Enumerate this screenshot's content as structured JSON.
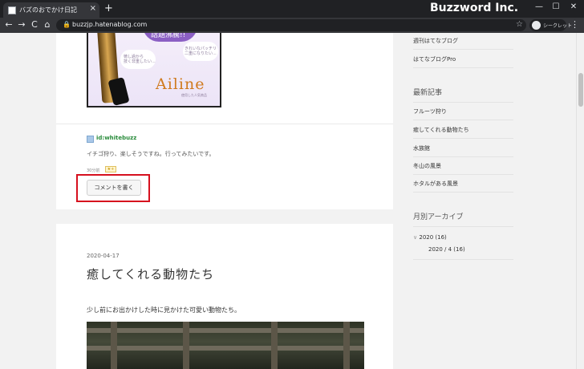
{
  "browser": {
    "tab_title": "バズのおでかけ日記",
    "new_tab": "+",
    "close": "×",
    "brand": "Buzzword Inc.",
    "url": "buzzjp.hatenablog.com",
    "incognito_label": "シークレット",
    "nav": {
      "back": "←",
      "forward": "→",
      "reload": "C",
      "home": "⌂"
    },
    "window": {
      "minimize": "—",
      "maximize": "☐",
      "close": "✕"
    },
    "star": "☆",
    "menu": "⋮",
    "lock": "🔒"
  },
  "ad": {
    "bubble_text": "話題沸騰!!",
    "note_left": "徳し過から\n技く非重したい...",
    "note_right": "きれいなパッチリ\n二重になりたい...",
    "logo": "Ailine",
    "tag": "使用した人気商品"
  },
  "comment": {
    "user": "id:whitebuzz",
    "text": "イチゴ狩り、楽しそうですね。行ってみたいです。",
    "time": "30分前",
    "star_label": "★+",
    "button_label": "コメントを書く"
  },
  "post": {
    "date": "2020-04-17",
    "title": "癒してくれる動物たち",
    "body": "少し前にお出かけした時に見かけた可愛い動物たち。"
  },
  "sidebar": {
    "top_links": [
      "週刊はてなブログ",
      "はてなブログPro"
    ],
    "recent_heading": "最新記事",
    "recent": [
      "フルーツ狩り",
      "癒してくれる動物たち",
      "水族館",
      "冬山の風景",
      "ホタルがある風景"
    ],
    "archive_heading": "月別アーカイブ",
    "archive_year": "2020 (16)",
    "archive_month": "2020 / 4 (16)",
    "archive_toggle": "∨"
  }
}
